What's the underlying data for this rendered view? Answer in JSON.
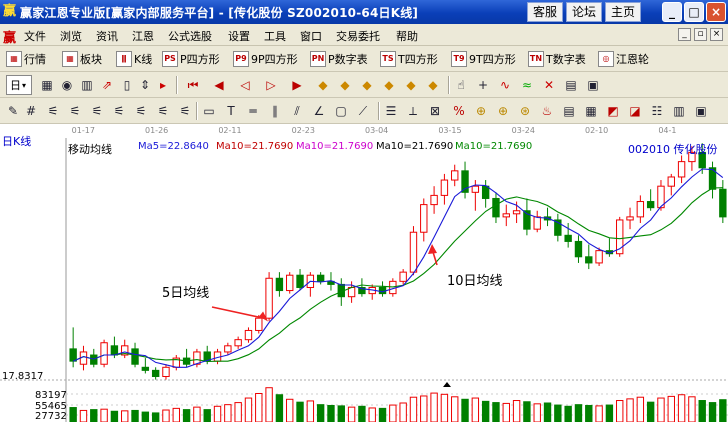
{
  "window": {
    "app_icon": "赢",
    "title": "赢家江恩专业版[赢家内部服务平台] - [传化股份  SZ002010-64日K线]",
    "links": [
      "客服",
      "论坛",
      "主页"
    ],
    "min": "_",
    "max": "□",
    "close": "×"
  },
  "menu": {
    "icon": "赢",
    "items": [
      "文件",
      "浏览",
      "资讯",
      "江恩",
      "公式选股",
      "设置",
      "工具",
      "窗口",
      "交易委托",
      "帮助"
    ]
  },
  "toolbar1": {
    "buttons": [
      {
        "icon": "▦",
        "label": "行情"
      },
      {
        "icon": "▦",
        "label": "板块"
      },
      {
        "icon": "ǁ",
        "label": "K线"
      },
      {
        "icon": "PS",
        "label": "P四方形"
      },
      {
        "icon": "P9",
        "label": "9P四方形"
      },
      {
        "icon": "PN",
        "label": "P数字表"
      },
      {
        "icon": "TS",
        "label": "T四方形"
      },
      {
        "icon": "T9",
        "label": "9T四方形"
      },
      {
        "icon": "TN",
        "label": "T数字表"
      },
      {
        "icon": "◎",
        "label": "江恩轮"
      }
    ]
  },
  "toolbar2": {
    "period": "日",
    "icons": [
      "grid-icon",
      "target-icon",
      "bars-icon",
      "trend-icon",
      "candle-icon",
      "scale-icon",
      "first-icon",
      "prev-icon",
      "back-icon",
      "forward-icon",
      "next-icon",
      "last-icon",
      "diamond-up-icon",
      "diamond-left-icon",
      "diamond-right-icon",
      "diamond-down-icon",
      "diamond-in-icon",
      "diamond-out-icon",
      "diamond-a-icon",
      "diamond-b-icon",
      "pointer-icon",
      "crosshair-icon",
      "curve-icon",
      "wave-icon",
      "xline-icon",
      "pane-a-icon",
      "pane-b-icon"
    ]
  },
  "chart": {
    "period_label": "日K线",
    "indicator_name": "移动均线",
    "ma_labels": [
      {
        "text": "Ma5=22.8640",
        "color": "#1a1ad8"
      },
      {
        "text": "Ma10=21.7690",
        "color": "#c00000"
      },
      {
        "text": "Ma10=21.7690",
        "color": "#cc00cc"
      },
      {
        "text": "Ma10=21.7690",
        "color": "#000000"
      },
      {
        "text": "Ma10=21.7690",
        "color": "#008800"
      }
    ],
    "stock_label": "002010 传化股份",
    "date_labels": [
      "01-17",
      "01-26",
      "02-11",
      "02-23",
      "03-04",
      "03-15",
      "03-24",
      "02-10",
      "04-1"
    ],
    "price_axis_label": "17.8317",
    "volume_labels": [
      "83197",
      "55465",
      "27732"
    ],
    "annotation_ma5": "5日均线",
    "annotation_ma10": "10日均线",
    "colors": {
      "up": "#ee0000",
      "down": "#008000",
      "ma5": "#1a1ad8",
      "ma10": "#008800",
      "arrow": "#ee2222"
    }
  },
  "chart_data": {
    "type": "candlestick",
    "title": "传化股份 SZ002010 日K线",
    "price_axis_min": 17.8317,
    "ohlc": [
      [
        18.5,
        19.2,
        17.9,
        18.1
      ],
      [
        18.0,
        18.6,
        17.8,
        18.4
      ],
      [
        18.3,
        18.5,
        17.9,
        18.0
      ],
      [
        18.0,
        18.8,
        17.9,
        18.7
      ],
      [
        18.6,
        18.9,
        18.2,
        18.3
      ],
      [
        18.3,
        18.8,
        18.2,
        18.6
      ],
      [
        18.5,
        18.7,
        17.9,
        18.0
      ],
      [
        17.9,
        18.2,
        17.7,
        17.8
      ],
      [
        17.8,
        17.9,
        17.5,
        17.6
      ],
      [
        17.6,
        18.0,
        17.5,
        17.9
      ],
      [
        17.9,
        18.3,
        17.8,
        18.2
      ],
      [
        18.2,
        18.5,
        17.9,
        18.0
      ],
      [
        18.0,
        18.5,
        17.9,
        18.4
      ],
      [
        18.4,
        18.6,
        18.0,
        18.1
      ],
      [
        18.1,
        18.5,
        18.0,
        18.4
      ],
      [
        18.4,
        18.7,
        18.3,
        18.6
      ],
      [
        18.6,
        18.9,
        18.5,
        18.8
      ],
      [
        18.8,
        19.2,
        18.7,
        19.1
      ],
      [
        19.1,
        19.6,
        19.0,
        19.5
      ],
      [
        19.5,
        21.0,
        19.4,
        20.8
      ],
      [
        20.8,
        21.0,
        20.2,
        20.4
      ],
      [
        20.4,
        21.0,
        20.3,
        20.9
      ],
      [
        20.9,
        21.1,
        20.4,
        20.5
      ],
      [
        20.5,
        21.0,
        20.2,
        20.9
      ],
      [
        20.9,
        21.0,
        20.6,
        20.7
      ],
      [
        20.7,
        21.0,
        20.4,
        20.6
      ],
      [
        20.6,
        20.8,
        19.9,
        20.2
      ],
      [
        20.2,
        20.7,
        20.0,
        20.5
      ],
      [
        20.5,
        20.8,
        20.2,
        20.3
      ],
      [
        20.3,
        20.6,
        20.1,
        20.5
      ],
      [
        20.5,
        20.7,
        20.2,
        20.3
      ],
      [
        20.3,
        20.8,
        20.2,
        20.7
      ],
      [
        20.7,
        21.1,
        20.6,
        21.0
      ],
      [
        21.0,
        22.5,
        20.9,
        22.3
      ],
      [
        22.3,
        23.4,
        22.0,
        23.2
      ],
      [
        23.2,
        23.8,
        22.9,
        23.5
      ],
      [
        23.5,
        24.2,
        23.2,
        24.0
      ],
      [
        24.0,
        24.5,
        23.8,
        24.3
      ],
      [
        24.3,
        24.6,
        23.4,
        23.6
      ],
      [
        23.6,
        24.0,
        23.0,
        23.8
      ],
      [
        23.8,
        24.0,
        23.1,
        23.4
      ],
      [
        23.4,
        23.6,
        22.6,
        22.8
      ],
      [
        22.8,
        23.2,
        22.5,
        22.9
      ],
      [
        22.9,
        23.3,
        22.6,
        23.0
      ],
      [
        23.0,
        23.4,
        22.2,
        22.4
      ],
      [
        22.4,
        23.0,
        22.3,
        22.8
      ],
      [
        22.8,
        23.1,
        22.5,
        22.7
      ],
      [
        22.7,
        22.9,
        22.0,
        22.2
      ],
      [
        22.2,
        22.6,
        21.8,
        22.0
      ],
      [
        22.0,
        22.2,
        21.3,
        21.5
      ],
      [
        21.5,
        21.9,
        21.1,
        21.3
      ],
      [
        21.3,
        21.8,
        21.2,
        21.7
      ],
      [
        21.7,
        22.1,
        21.5,
        21.6
      ],
      [
        21.6,
        22.8,
        21.5,
        22.7
      ],
      [
        22.7,
        23.1,
        22.4,
        22.8
      ],
      [
        22.8,
        23.5,
        22.6,
        23.3
      ],
      [
        23.3,
        23.7,
        23.0,
        23.1
      ],
      [
        23.1,
        24.0,
        23.0,
        23.8
      ],
      [
        23.8,
        24.2,
        23.5,
        24.1
      ],
      [
        24.1,
        24.8,
        23.9,
        24.6
      ],
      [
        24.6,
        25.1,
        24.3,
        24.9
      ],
      [
        24.9,
        25.2,
        24.2,
        24.4
      ],
      [
        24.4,
        24.6,
        23.4,
        23.7
      ],
      [
        23.7,
        24.0,
        22.6,
        22.8
      ]
    ],
    "ma5_label": "5日均线",
    "ma10_label": "10日均线",
    "volume": [
      35000,
      28000,
      30000,
      31000,
      26000,
      27000,
      28000,
      24000,
      22000,
      29000,
      33000,
      30000,
      36000,
      30000,
      38000,
      42000,
      47000,
      58000,
      69000,
      83000,
      66000,
      55000,
      48000,
      51000,
      42000,
      40000,
      39000,
      36000,
      38000,
      34000,
      33000,
      41000,
      46000,
      60000,
      63000,
      70000,
      67000,
      61000,
      55000,
      58000,
      50000,
      47000,
      45000,
      52000,
      49000,
      44000,
      46000,
      41000,
      38000,
      42000,
      40000,
      39000,
      41000,
      52000,
      56000,
      60000,
      48000,
      58000,
      62000,
      66000,
      61000,
      52000,
      47000,
      54000
    ]
  }
}
